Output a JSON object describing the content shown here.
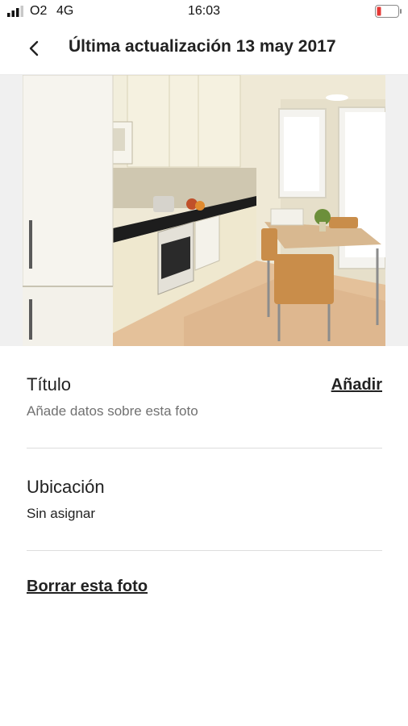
{
  "status_bar": {
    "carrier": "O2",
    "network": "4G",
    "time": "16:03",
    "battery_color": "#e53935"
  },
  "header": {
    "back_icon": "chevron-left-icon",
    "title": "Última actualización 13 may 2017"
  },
  "photo": {
    "edit_icon": "pencil-icon"
  },
  "title_section": {
    "label": "Título",
    "action": "Añadir",
    "placeholder": "Añade datos sobre esta foto"
  },
  "location_section": {
    "label": "Ubicación",
    "value": "Sin asignar"
  },
  "delete_action": "Borrar esta foto"
}
